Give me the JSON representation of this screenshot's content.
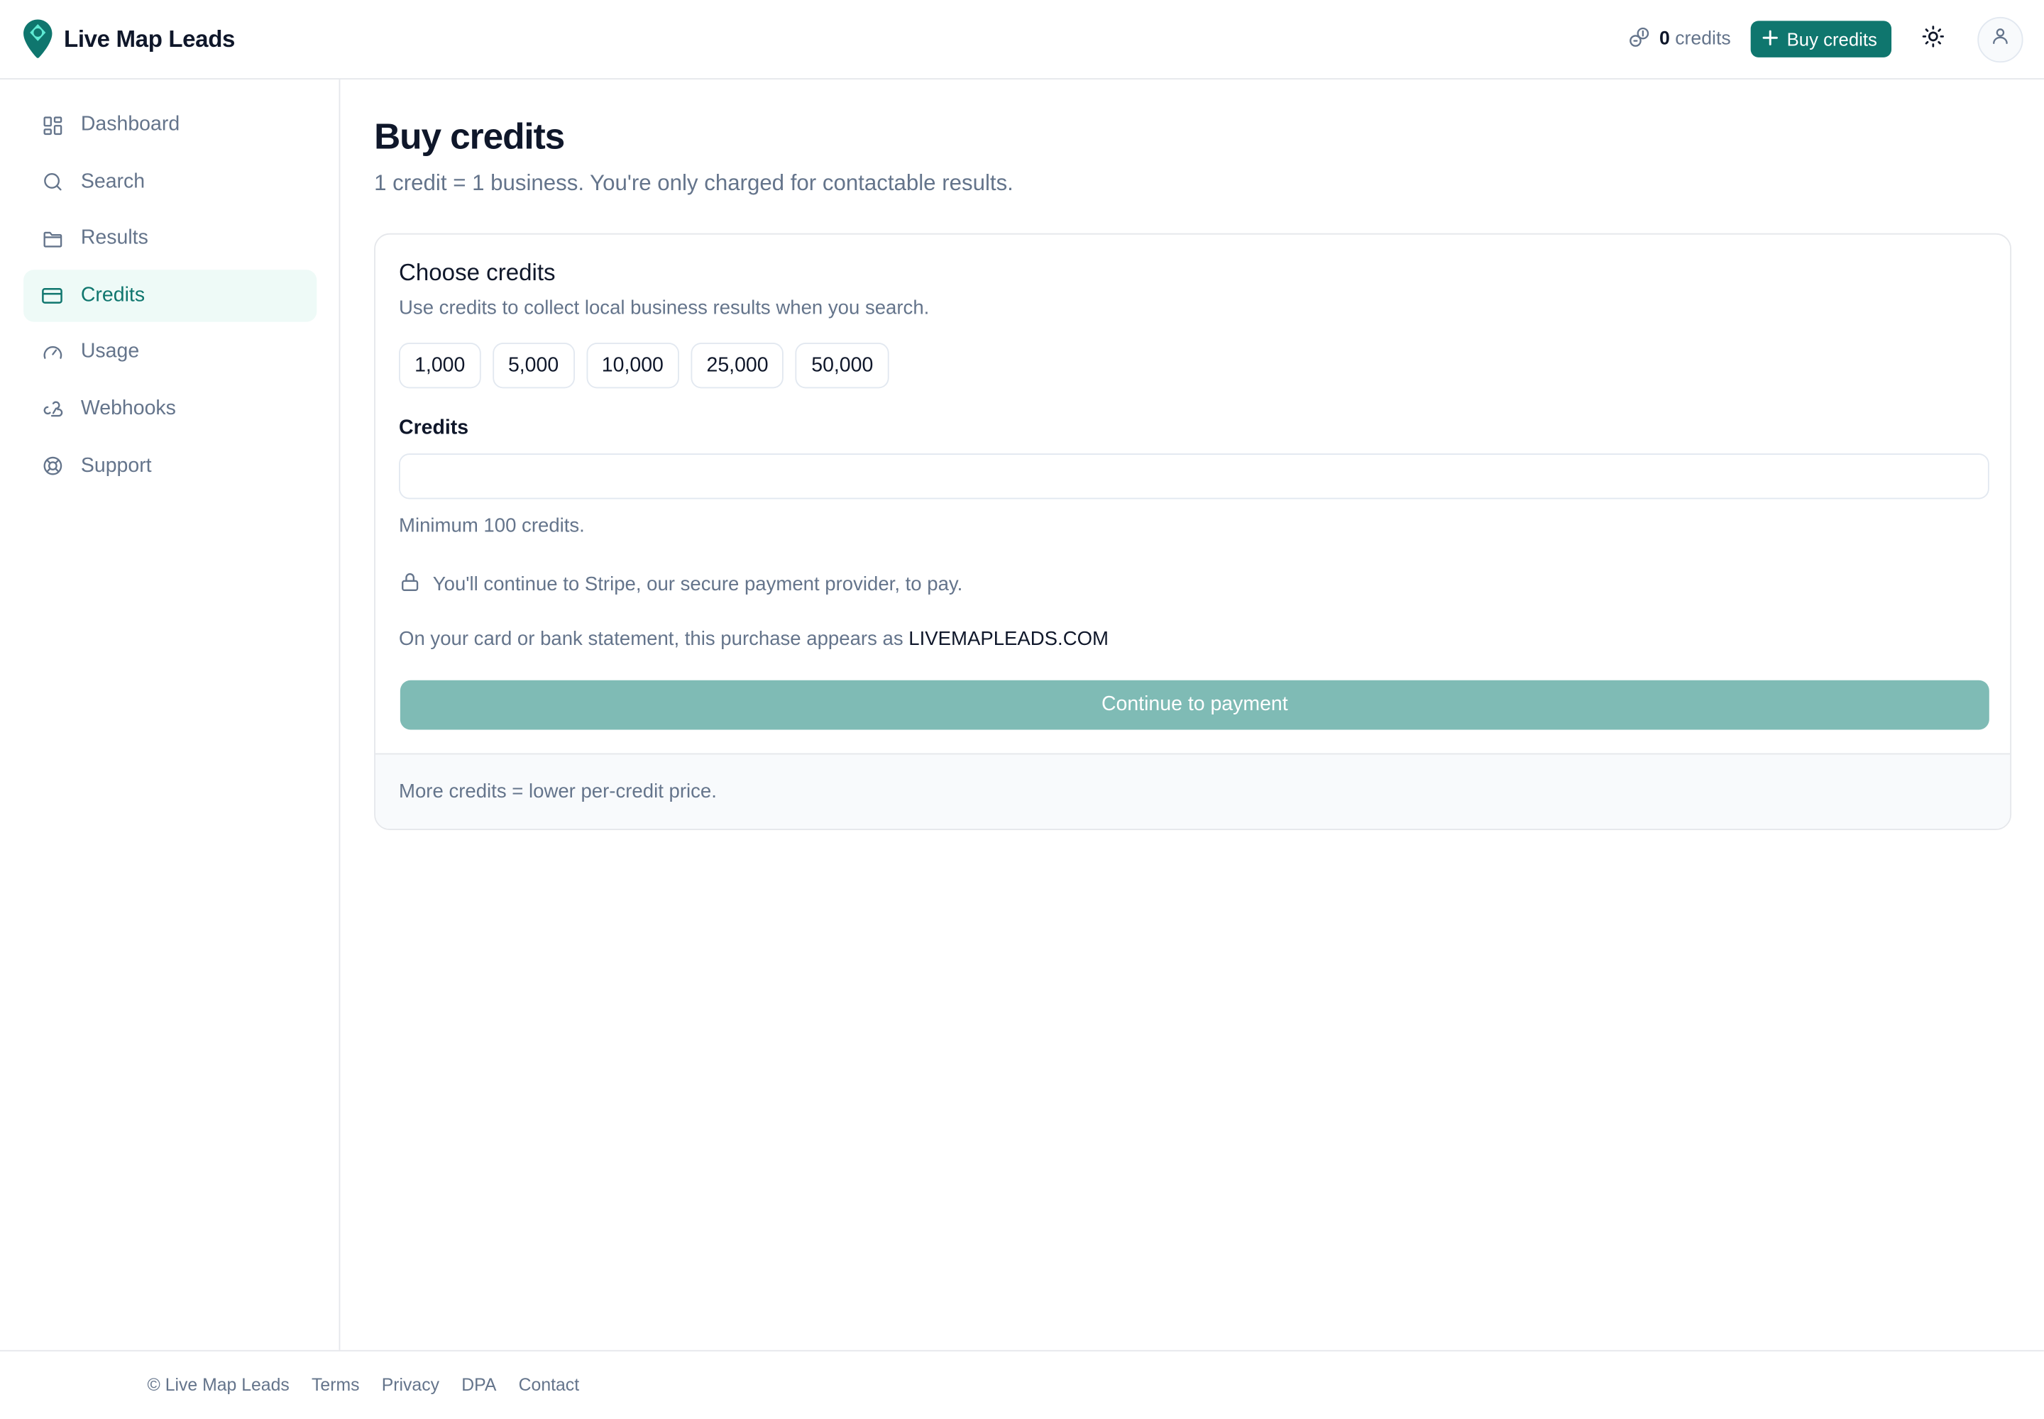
{
  "brand": {
    "name": "Live Map Leads",
    "logo_icon": "map-pin-icon",
    "accent": "#0f766e"
  },
  "header": {
    "credits_count": "0",
    "credits_unit": "credits",
    "buy_label": "Buy credits",
    "theme_icon": "sun-icon",
    "avatar_icon": "user-icon"
  },
  "sidebar": {
    "items": [
      {
        "label": "Dashboard",
        "icon": "dashboard-icon",
        "active": false
      },
      {
        "label": "Search",
        "icon": "search-icon",
        "active": false
      },
      {
        "label": "Results",
        "icon": "folder-icon",
        "active": false
      },
      {
        "label": "Credits",
        "icon": "credit-card-icon",
        "active": true
      },
      {
        "label": "Usage",
        "icon": "gauge-icon",
        "active": false
      },
      {
        "label": "Webhooks",
        "icon": "webhook-icon",
        "active": false
      },
      {
        "label": "Support",
        "icon": "lifebuoy-icon",
        "active": false
      }
    ]
  },
  "page": {
    "title": "Buy credits",
    "subtitle": "1 credit = 1 business. You're only charged for contactable results."
  },
  "card": {
    "title": "Choose credits",
    "description": "Use credits to collect local business results when you search.",
    "presets": [
      "1,000",
      "5,000",
      "10,000",
      "25,000",
      "50,000"
    ],
    "field_label": "Credits",
    "input_value": "",
    "hint": "Minimum 100 credits.",
    "secure_note": "You'll continue to Stripe, our secure payment provider, to pay.",
    "statement_prefix": "On your card or bank statement, this purchase appears as",
    "statement_descriptor": "LIVEMAPLEADS.COM",
    "pay_label": "Continue to payment",
    "footer_note": "More credits = lower per-credit price."
  },
  "footer": {
    "copyright": "© Live Map Leads",
    "links": [
      "Terms",
      "Privacy",
      "DPA",
      "Contact"
    ]
  }
}
